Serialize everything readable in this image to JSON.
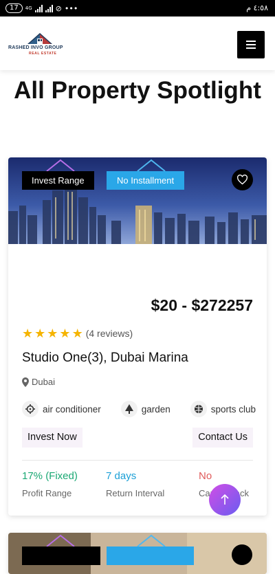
{
  "status_bar": {
    "sim_badge": "17",
    "network": "4G",
    "dots": "•••",
    "time": "٤:٥٨ م"
  },
  "header": {
    "logo_line1": "RASHED INVO GROUP",
    "logo_line2": "REAL ESTATE",
    "logo_icon": "house-roof-icon",
    "menu_icon": "hamburger-icon"
  },
  "page": {
    "title": "All Property Spotlight"
  },
  "card": {
    "badge_invest_range": "Invest Range",
    "badge_installment": "No Installment",
    "favorite_icon": "heart-icon",
    "price": "$20 - $272257",
    "rating_stars": 5,
    "reviews": "(4 reviews)",
    "title": "Studio One(3), Dubai Marina",
    "location": "Dubai",
    "amenities": [
      {
        "label": "air conditioner",
        "icon": "crosshair-icon"
      },
      {
        "label": "garden",
        "icon": "tree-icon"
      },
      {
        "label": "sports club",
        "icon": "ball-icon"
      }
    ],
    "invest_now": "Invest Now",
    "contact_us": "Contact Us",
    "stats": [
      {
        "value": "17% (Fixed)",
        "label": "Profit Range",
        "color": "#1aa873"
      },
      {
        "value": "7 days",
        "label": "Return Interval",
        "color": "#1a9fd6"
      },
      {
        "value": "No",
        "label": "Capital Back",
        "color": "#e05a5a"
      }
    ]
  },
  "colors": {
    "accent_blue": "#2aa7e8",
    "star": "#f5b400",
    "scroll_top_gradient": [
      "#d14ee6",
      "#6a5cf0"
    ]
  },
  "scroll_top_icon": "arrow-up-icon"
}
